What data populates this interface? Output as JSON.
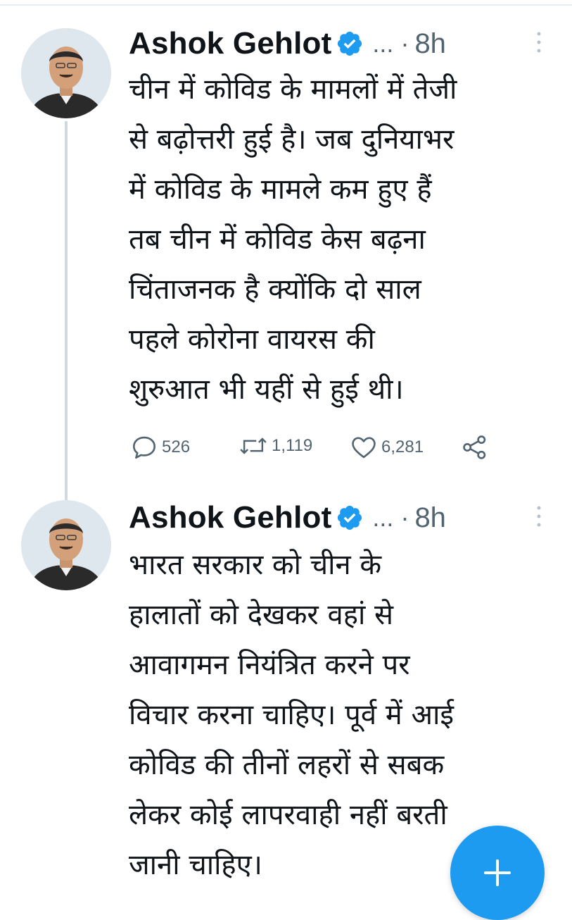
{
  "colors": {
    "accent": "#1d9bf0",
    "text": "#0f1419",
    "muted": "#536471",
    "thread_line": "#cfd9de"
  },
  "tweets": [
    {
      "author_name": "Ashok Gehlot",
      "verified_icon": "verified-badge-icon",
      "handle_ellipsis": "...",
      "separator": "·",
      "time": "8h",
      "text_lines": [
        "चीन में कोविड के मामलों में तेजी",
        "से बढ़ोत्तरी हुई है। जब दुनियाभर",
        "में कोविड के मामले कम हुए हैं",
        "तब चीन में कोविड केस बढ़ना",
        "चिंताजनक है क्योंकि दो साल",
        "पहले कोरोना वायरस की",
        "शुरुआत भी यहीं से हुई थी।"
      ],
      "actions": {
        "reply_count": "526",
        "retweet_count": "1,119",
        "like_count": "6,281"
      }
    },
    {
      "author_name": "Ashok Gehlot",
      "verified_icon": "verified-badge-icon",
      "handle_ellipsis": "...",
      "separator": "·",
      "time": "8h",
      "text_lines": [
        "भारत सरकार को चीन के",
        "हालातों को देखकर वहां से",
        "आवागमन नियंत्रित करने पर",
        "विचार करना चाहिए। पूर्व में आई",
        "कोविड की तीनों लहरों से सबक",
        "लेकर कोई लापरवाही नहीं बरती",
        "जानी चाहिए।"
      ]
    }
  ],
  "fab": {
    "icon": "plus-icon"
  }
}
